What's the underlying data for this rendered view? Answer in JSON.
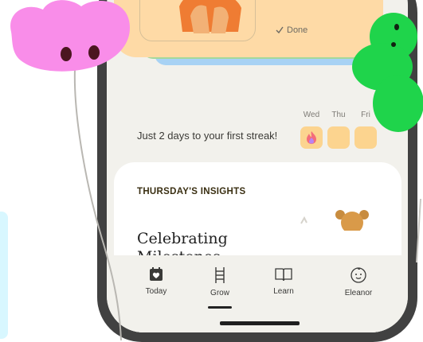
{
  "card": {
    "done_label": "Done"
  },
  "streak": {
    "message": "Just 2 days to your first streak!",
    "days": [
      {
        "label": "Wed",
        "completed": true
      },
      {
        "label": "Thu",
        "completed": false
      },
      {
        "label": "Fri",
        "completed": false
      }
    ]
  },
  "insights": {
    "heading": "THURSDAY'S INSIGHTS",
    "article_title": "Celebrating",
    "article_title_partial": "Milestones"
  },
  "nav": {
    "items": [
      {
        "label": "Today",
        "icon": "calendar-heart-icon"
      },
      {
        "label": "Grow",
        "icon": "ladder-icon"
      },
      {
        "label": "Learn",
        "icon": "book-icon"
      },
      {
        "label": "Eleanor",
        "icon": "baby-face-icon"
      }
    ],
    "active": "Grow"
  },
  "colors": {
    "peach_card": "#fedaa6",
    "streak_box": "#fcd48f",
    "pink_sticker": "#f98de9",
    "green_sticker": "#1fd44b",
    "phone_frame": "#414141"
  }
}
